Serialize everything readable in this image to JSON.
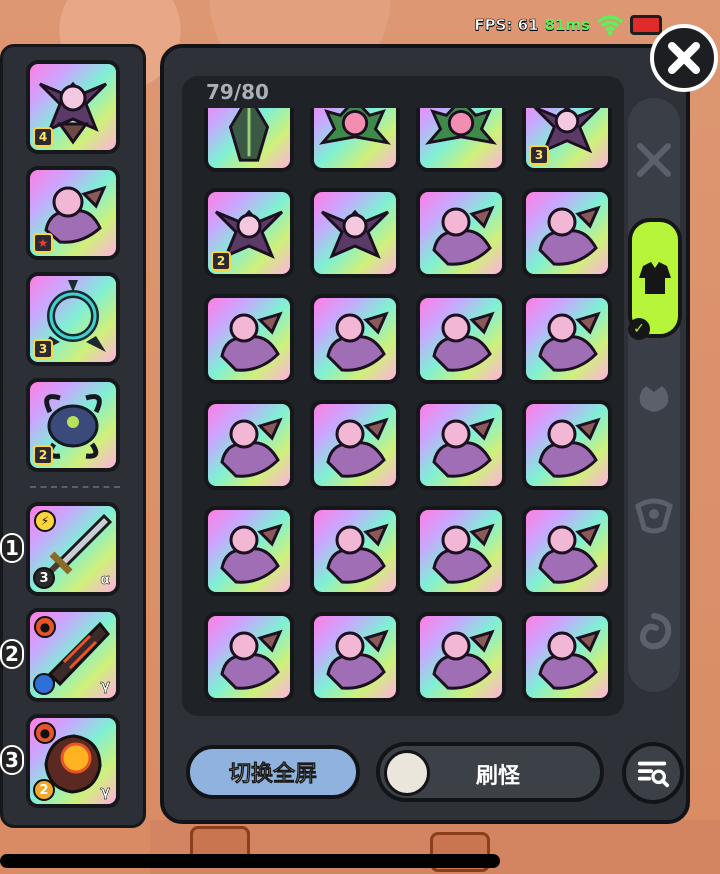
{
  "hud": {
    "fps_label": "FPS: 61",
    "ping": "81ms"
  },
  "inventory": {
    "count": "79/80"
  },
  "equipped_slots": [
    {
      "item": "winged-demon",
      "level": "4"
    },
    {
      "item": "pink-dragon",
      "level": "★"
    },
    {
      "item": "thorn-ring",
      "level": "3"
    },
    {
      "item": "horned-beetle",
      "level": "2"
    }
  ],
  "weapons": [
    {
      "slot": "1",
      "item": "great-sword",
      "element_icon": "lightning-icon",
      "level": "3",
      "grade": "α"
    },
    {
      "slot": "2",
      "item": "lava-blade",
      "element_icon": "fire-icon",
      "level": "",
      "grade": "γ"
    },
    {
      "slot": "3",
      "item": "magma-core",
      "element_icon": "fire-icon",
      "level": "2",
      "grade": "γ"
    }
  ],
  "grid_items": [
    [
      "green-beetle",
      "lotus-crest",
      "lotus-crest",
      "winged-demon:3"
    ],
    [
      "winged-demon:2",
      "winged-demon",
      "pink-dragon",
      "pink-dragon"
    ],
    [
      "pink-dragon",
      "pink-dragon",
      "pink-dragon",
      "pink-dragon"
    ],
    [
      "pink-dragon",
      "pink-dragon",
      "pink-dragon",
      "pink-dragon"
    ],
    [
      "pink-dragon",
      "pink-dragon",
      "pink-dragon",
      "pink-dragon"
    ],
    [
      "pink-dragon",
      "pink-dragon",
      "pink-dragon",
      "pink-dragon"
    ]
  ],
  "tabs": [
    {
      "icon": "crossed-swords-icon",
      "active": false
    },
    {
      "icon": "armor-icon",
      "active": true
    },
    {
      "icon": "bag-icon",
      "active": false
    },
    {
      "icon": "emblem-icon",
      "active": false
    },
    {
      "icon": "swirl-icon",
      "active": false
    }
  ],
  "buttons": {
    "fullscreen": "切换全屏",
    "spawn": "刷怪"
  },
  "colors": {
    "active_tab": "#b6f53a",
    "fullscreen_btn": "#8fb3de",
    "ping_green": "#5ef05a"
  }
}
